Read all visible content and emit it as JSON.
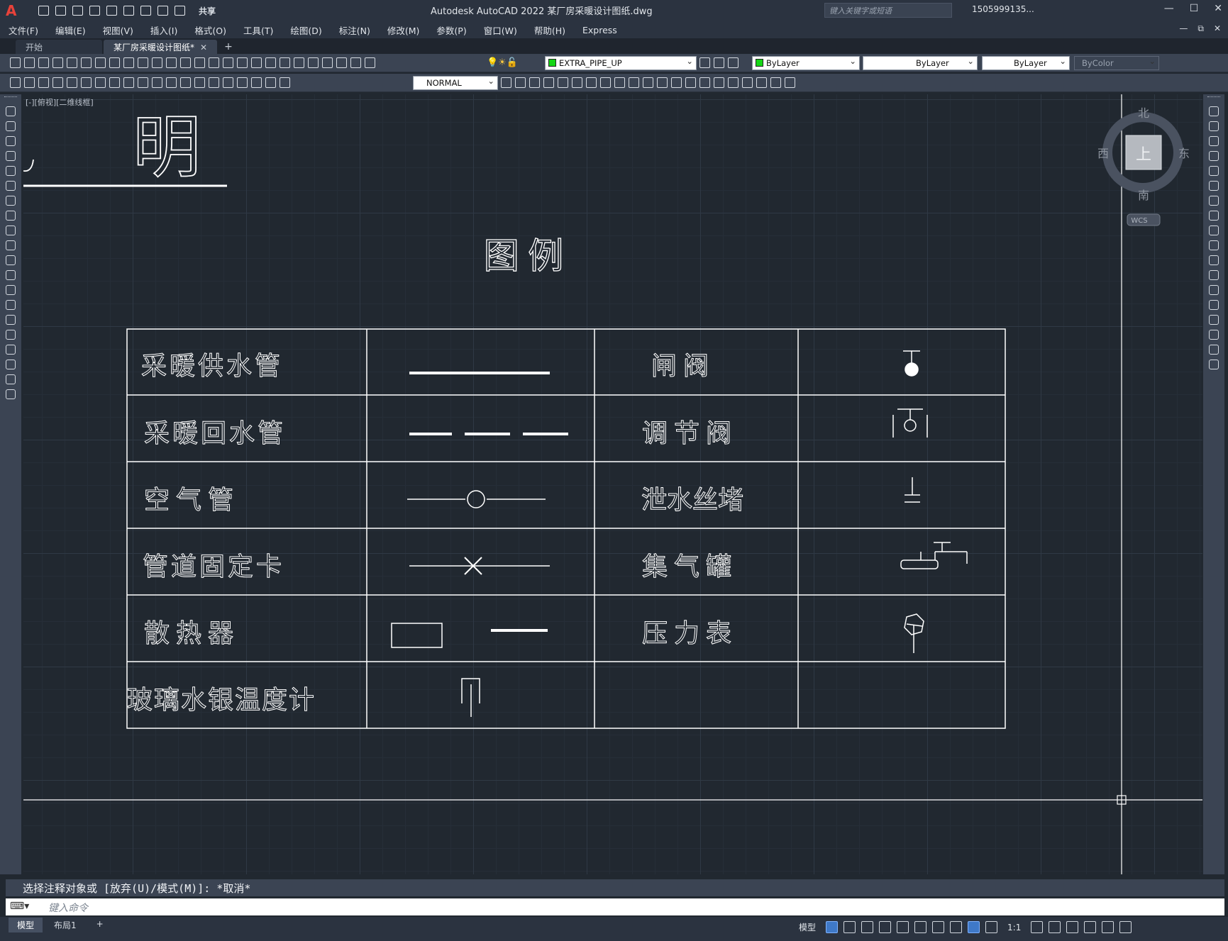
{
  "app": {
    "logo": "A",
    "title": "Autodesk AutoCAD 2022    某厂房采暖设计图纸.dwg",
    "share_label": "共享",
    "search_placeholder": "键入关键字或短语",
    "user": "1505999135...",
    "window_controls": [
      "—",
      "☐",
      "✕"
    ]
  },
  "menu": {
    "items": [
      "文件(F)",
      "编辑(E)",
      "视图(V)",
      "插入(I)",
      "格式(O)",
      "工具(T)",
      "绘图(D)",
      "标注(N)",
      "修改(M)",
      "参数(P)",
      "窗口(W)",
      "帮助(H)",
      "Express"
    ],
    "right_controls": [
      "—",
      "⧉",
      "✕"
    ]
  },
  "tabs": {
    "items": [
      {
        "label": "开始",
        "active": false
      },
      {
        "label": "某厂房采暖设计图纸*",
        "active": true
      }
    ],
    "close_glyph": "✕",
    "add_glyph": "+"
  },
  "toolbar": {
    "layer": "EXTRA_PIPE_UP",
    "color": "ByLayer",
    "linetype": "ByLayer",
    "lineweight": "ByLayer",
    "plotstyle": "ByColor",
    "dimstyle": "NORMAL",
    "layer_color": "#16d616"
  },
  "viewport": {
    "label": "[-][俯视][二维线框]"
  },
  "drawing": {
    "heading_partial": "明",
    "legend_title": "图    例",
    "rows": [
      {
        "left_label": "采暖供水管",
        "right_label": "闸  阀"
      },
      {
        "left_label": "采暖回水管",
        "right_label": "调 节 阀"
      },
      {
        "left_label": "空  气  管",
        "right_label": "泄水丝堵"
      },
      {
        "left_label": "管道固定卡",
        "right_label": "集 气 罐"
      },
      {
        "left_label": "散  热  器",
        "right_label": "压 力 表"
      },
      {
        "left_label": "玻璃水银温度计",
        "right_label": ""
      }
    ]
  },
  "viewcube": {
    "north": "北",
    "south": "南",
    "east": "东",
    "west": "西",
    "face": "上",
    "wcs": "WCS"
  },
  "command": {
    "history": "选择注释对象或 [放弃(U)/模式(M)]: *取消*",
    "placeholder": "键入命令"
  },
  "status": {
    "layout_tabs": [
      "模型",
      "布局1"
    ],
    "add_layout": "+",
    "model_label": "模型",
    "scale": "1:1"
  }
}
